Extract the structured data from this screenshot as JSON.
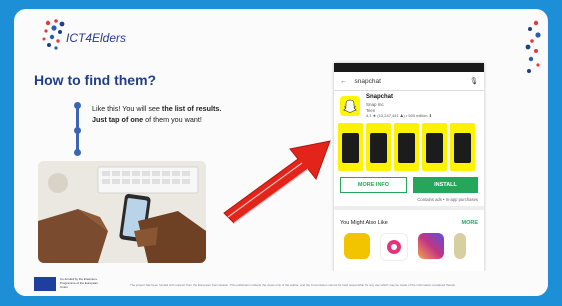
{
  "brand": {
    "logo_text": "ICT4Elders",
    "frame_color": "#1d8fd6",
    "accent": "#1f3f8a",
    "arrow_color": "#e2241b"
  },
  "slide": {
    "heading": "How to find them?",
    "bullet_1_pre": "Like this! You will see ",
    "bullet_1_bold": "the list of results.",
    "bullet_2_bold": "Just tap of one",
    "bullet_2_post": " of them you want!"
  },
  "phone": {
    "search_query": "snapchat",
    "app_name": "Snapchat",
    "app_developer": "Snap Inc",
    "app_age": "Teen",
    "app_rating": "4.1 ★ (13,247,441 ♟) • 500 million ⬇",
    "more_info_label": "MORE INFO",
    "install_label": "INSTALL",
    "contains_text": "Contains ads • In-app purchases",
    "you_might_also_like": "You Might Also Like",
    "more_label": "MORE",
    "icons": {
      "back": "arrow-left-icon",
      "mic": "microphone-icon",
      "snapchat": "snapchat-ghost-icon"
    }
  },
  "footer": {
    "eu_text": "Co-funded by the Erasmus+ Programme of the European Union",
    "disclaimer": "The project has been funded with support from the European Commission. This publication reflects the views only of the author, and the Commission cannot be held responsible for any use which may be made of the information contained therein."
  }
}
